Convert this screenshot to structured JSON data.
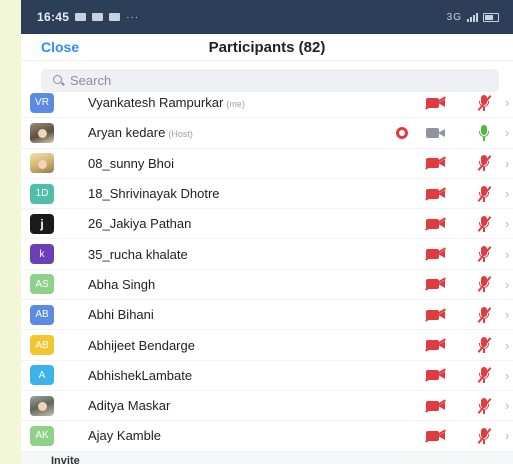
{
  "status_bar": {
    "time": "16:45",
    "dots": "···",
    "right_text": "3G"
  },
  "header": {
    "close_label": "Close",
    "title": "Participants (82)"
  },
  "search": {
    "placeholder": "Search"
  },
  "participants": [
    {
      "avatar_text": "VR",
      "avatar_color": "#5b8be3",
      "name": "Vyankatesh Rampurkar",
      "tag": "(me)",
      "avatar_kind": "initials",
      "video": "off",
      "audio": "muted"
    },
    {
      "avatar_text": "",
      "avatar_color": "#6b5a48",
      "name": "Aryan kedare",
      "tag": "(Host)",
      "avatar_kind": "photo",
      "video": "off-gray",
      "audio": "on",
      "recording": true
    },
    {
      "avatar_text": "",
      "avatar_color": "#d6b26a",
      "name": "08_sunny Bhoi",
      "tag": "",
      "avatar_kind": "photo2",
      "video": "off",
      "audio": "muted"
    },
    {
      "avatar_text": "1D",
      "avatar_color": "#4fbfaa",
      "name": "18_Shrivinayak Dhotre",
      "tag": "",
      "avatar_kind": "initials",
      "video": "off",
      "audio": "muted"
    },
    {
      "avatar_text": "j",
      "avatar_color": "#1a1a1a",
      "name": "26_Jakiya Pathan",
      "tag": "",
      "avatar_kind": "initials",
      "video": "off",
      "audio": "muted"
    },
    {
      "avatar_text": "k",
      "avatar_color": "#6a3fb8",
      "name": "35_rucha khalate",
      "tag": "",
      "avatar_kind": "initials",
      "video": "off",
      "audio": "muted"
    },
    {
      "avatar_text": "AS",
      "avatar_color": "#8fd18a",
      "name": "Abha Singh",
      "tag": "",
      "avatar_kind": "initials",
      "video": "off",
      "audio": "muted"
    },
    {
      "avatar_text": "AB",
      "avatar_color": "#5b8be3",
      "name": "Abhi Bihani",
      "tag": "",
      "avatar_kind": "initials",
      "video": "off",
      "audio": "muted"
    },
    {
      "avatar_text": "AB",
      "avatar_color": "#f2c531",
      "name": "Abhijeet Bendarge",
      "tag": "",
      "avatar_kind": "initials",
      "video": "off",
      "audio": "muted"
    },
    {
      "avatar_text": "A",
      "avatar_color": "#3bb3e8",
      "name": "AbhishekLambate",
      "tag": "",
      "avatar_kind": "initials",
      "video": "off",
      "audio": "muted"
    },
    {
      "avatar_text": "",
      "avatar_color": "#7a7f6a",
      "name": "Aditya Maskar",
      "tag": "",
      "avatar_kind": "photo3",
      "video": "off",
      "audio": "muted"
    },
    {
      "avatar_text": "AK",
      "avatar_color": "#8fd18a",
      "name": "Ajay Kamble",
      "tag": "",
      "avatar_kind": "initials",
      "video": "off",
      "audio": "muted"
    }
  ],
  "footer": {
    "invite_label": "Invite"
  },
  "colors": {
    "accent": "#2d8cff",
    "muted_red": "#e03b3f",
    "live_green": "#4cbb3c"
  }
}
